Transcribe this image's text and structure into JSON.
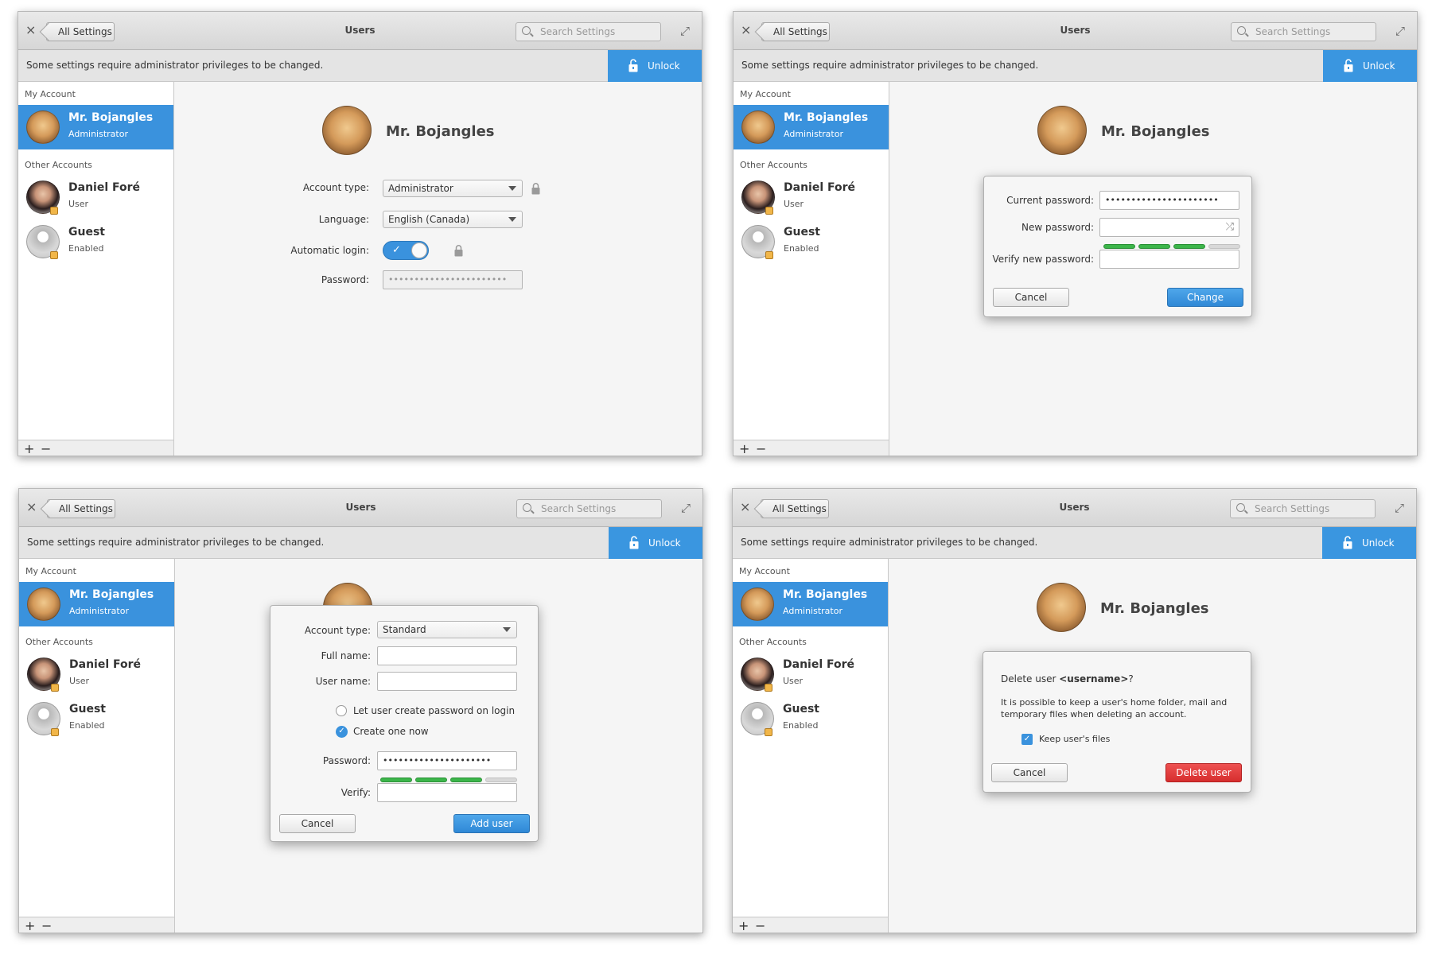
{
  "common": {
    "back_label": "All Settings",
    "window_title": "Users",
    "search_placeholder": "Search Settings",
    "info_text": "Some settings require administrator privileges to be changed.",
    "unlock_label": "Unlock",
    "my_account_heading": "My Account",
    "other_accounts_heading": "Other Accounts",
    "add_symbol": "+",
    "remove_symbol": "−",
    "close_symbol": "×",
    "maximize_symbol": "⤢"
  },
  "accounts": [
    {
      "name": "Mr. Bojangles",
      "role": "Administrator"
    },
    {
      "name": "Daniel Foré",
      "role": "User"
    },
    {
      "name": "Guest",
      "role": "Enabled"
    }
  ],
  "panel1": {
    "user_name": "Mr. Bojangles",
    "account_type_label": "Account type:",
    "account_type_value": "Administrator",
    "language_label": "Language:",
    "language_value": "English (Canada)",
    "auto_login_label": "Automatic login:",
    "auto_login_on": true,
    "password_label": "Password:",
    "password_value": "•••••••••••••••••••••••"
  },
  "panel2": {
    "current_password_label": "Current password:",
    "current_password_value": "••••••••••••••••••••••",
    "new_password_label": "New password:",
    "new_password_value": "",
    "verify_label": "Verify new password:",
    "verify_value": "",
    "strength_filled": 3,
    "strength_total": 4,
    "cancel_label": "Cancel",
    "change_label": "Change"
  },
  "panel3": {
    "account_type_label": "Account type:",
    "account_type_value": "Standard",
    "full_name_label": "Full name:",
    "full_name_value": "",
    "user_name_label": "User name:",
    "user_name_value": "",
    "option_login": "Let user create password on login",
    "option_now": "Create one now",
    "password_label": "Password:",
    "password_value": "•••••••••••••••••••••",
    "verify_label": "Verify:",
    "verify_value": "",
    "strength_filled": 3,
    "strength_total": 4,
    "cancel_label": "Cancel",
    "add_label": "Add user"
  },
  "panel4": {
    "delete_prefix": "Delete user ",
    "delete_username": "<username>",
    "delete_suffix": "?",
    "description": "It is possible to keep a user's home folder, mail and temporary files when deleting an account.",
    "keep_files_label": "Keep user's files",
    "keep_files_checked": true,
    "cancel_label": "Cancel",
    "delete_label": "Delete user"
  },
  "colors": {
    "accent": "#3a92dd",
    "danger": "#d62e2e",
    "strength": "#3cb54a"
  }
}
